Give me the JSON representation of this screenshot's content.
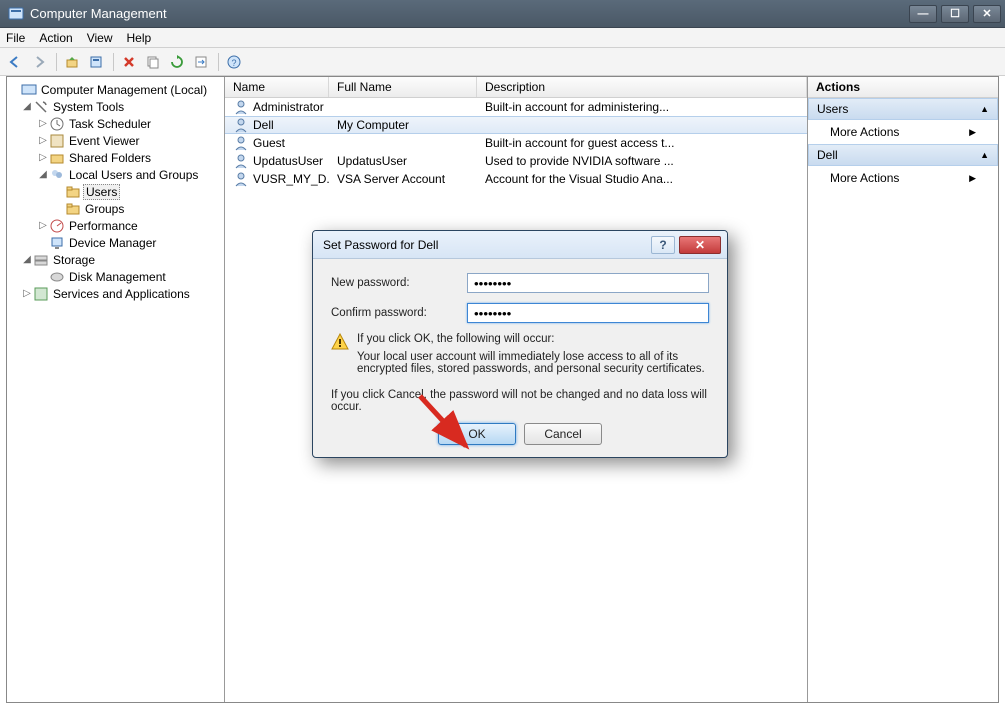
{
  "window": {
    "title": "Computer Management"
  },
  "menu": {
    "file": "File",
    "action": "Action",
    "view": "View",
    "help": "Help"
  },
  "tree": {
    "root": "Computer Management (Local)",
    "system_tools": "System Tools",
    "task_scheduler": "Task Scheduler",
    "event_viewer": "Event Viewer",
    "shared_folders": "Shared Folders",
    "local_users": "Local Users and Groups",
    "users": "Users",
    "groups": "Groups",
    "performance": "Performance",
    "device_manager": "Device Manager",
    "storage": "Storage",
    "disk_mgmt": "Disk Management",
    "services_apps": "Services and Applications"
  },
  "list": {
    "headers": {
      "name": "Name",
      "fullname": "Full Name",
      "description": "Description"
    },
    "rows": [
      {
        "name": "Administrator",
        "fullname": "",
        "description": "Built-in account for administering..."
      },
      {
        "name": "Dell",
        "fullname": "My Computer",
        "description": ""
      },
      {
        "name": "Guest",
        "fullname": "",
        "description": "Built-in account for guest access t..."
      },
      {
        "name": "UpdatusUser",
        "fullname": "UpdatusUser",
        "description": "Used to provide NVIDIA software ..."
      },
      {
        "name": "VUSR_MY_D...",
        "fullname": "VSA Server Account",
        "description": "Account for the Visual Studio Ana..."
      }
    ]
  },
  "actions": {
    "header": "Actions",
    "section1": "Users",
    "more1": "More Actions",
    "section2": "Dell",
    "more2": "More Actions"
  },
  "dialog": {
    "title": "Set Password for Dell",
    "new_pw_label": "New password:",
    "new_pw_value": "••••••••",
    "confirm_pw_label": "Confirm password:",
    "confirm_pw_value": "••••••••",
    "warn_line": "If you click OK, the following will occur:",
    "warn_body": "Your local user account will immediately lose access to all of its encrypted files, stored passwords, and personal security certificates.",
    "cancel_msg": "If you click Cancel, the password will not be changed and no data loss will occur.",
    "ok": "OK",
    "cancel": "Cancel"
  }
}
